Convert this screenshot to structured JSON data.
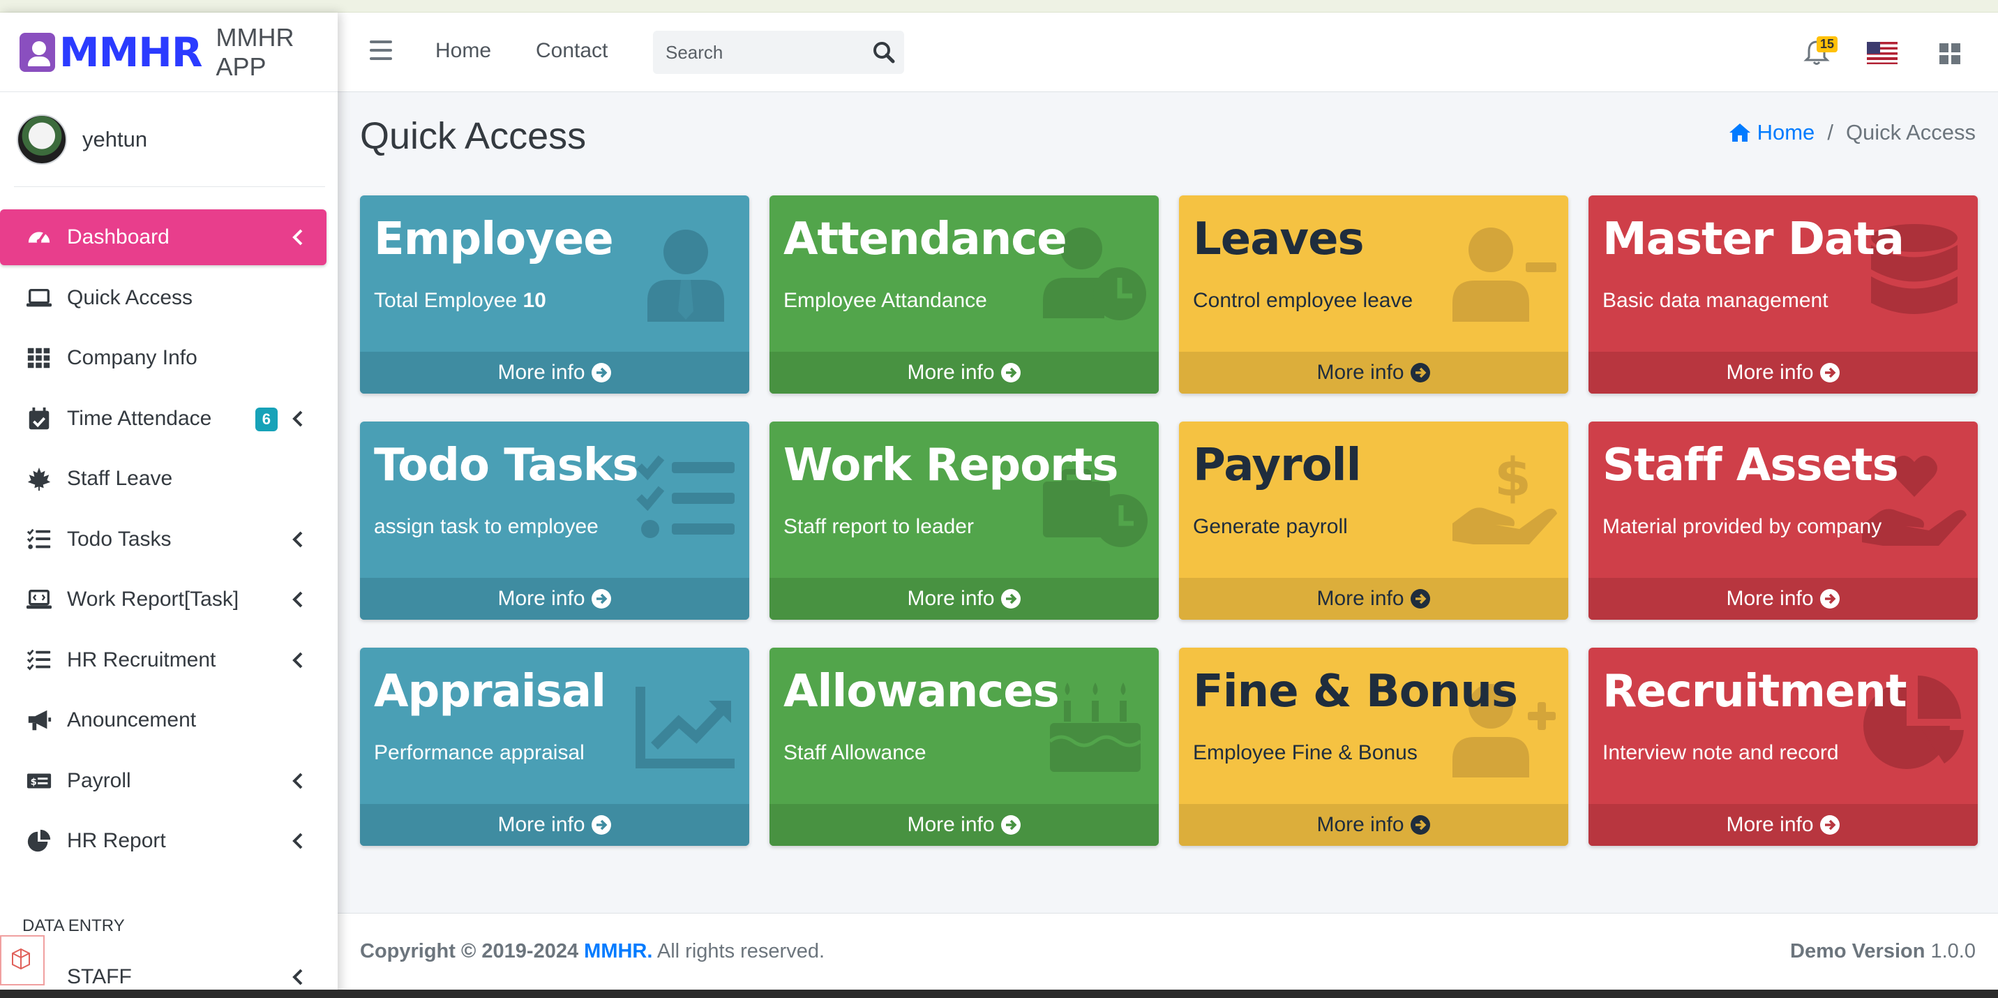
{
  "brand": {
    "logo_text": "MMHR",
    "app_name": "MMHR APP"
  },
  "user": {
    "name": "yehtun"
  },
  "sidebar": {
    "items": [
      {
        "label": "Dashboard",
        "icon": "tachometer-icon",
        "chevron": true
      },
      {
        "label": "Quick Access",
        "icon": "laptop-icon",
        "chevron": false
      },
      {
        "label": "Company Info",
        "icon": "grid-icon",
        "chevron": false
      },
      {
        "label": "Time Attendace",
        "icon": "calendar-check-icon",
        "chevron": true,
        "badge": "6"
      },
      {
        "label": "Staff Leave",
        "icon": "maple-leaf-icon",
        "chevron": false
      },
      {
        "label": "Todo Tasks",
        "icon": "tasks-icon",
        "chevron": true
      },
      {
        "label": "Work Report[Task]",
        "icon": "laptop-code-icon",
        "chevron": true
      },
      {
        "label": "HR Recruitment",
        "icon": "list-check-icon",
        "chevron": true
      },
      {
        "label": "Anouncement",
        "icon": "bullhorn-icon",
        "chevron": false
      },
      {
        "label": "Payroll",
        "icon": "money-check-icon",
        "chevron": true
      },
      {
        "label": "HR Report",
        "icon": "pie-chart-icon",
        "chevron": true
      }
    ],
    "section_header": "DATA ENTRY",
    "partial_item": "STAFF"
  },
  "header": {
    "links": [
      "Home",
      "Contact"
    ],
    "search_placeholder": "Search",
    "notification_count": "15"
  },
  "page": {
    "title": "Quick Access",
    "breadcrumb": {
      "home": "Home",
      "current": "Quick Access"
    }
  },
  "cards": [
    {
      "title": "Employee",
      "subtitle": "Total Employee ",
      "subtitle_bold": "10",
      "footer": "More info",
      "color": "info",
      "icon": "user-tie-icon"
    },
    {
      "title": "Attendance",
      "subtitle": "Employee Attandance",
      "subtitle_bold": "",
      "footer": "More info",
      "color": "success",
      "icon": "user-clock-icon"
    },
    {
      "title": "Leaves",
      "subtitle": "Control employee leave",
      "subtitle_bold": "",
      "footer": "More info",
      "color": "warning",
      "icon": "user-minus-icon"
    },
    {
      "title": "Master Data",
      "subtitle": "Basic data management",
      "subtitle_bold": "",
      "footer": "More info",
      "color": "danger",
      "icon": "database-icon"
    },
    {
      "title": "Todo Tasks",
      "subtitle": "assign task to employee",
      "subtitle_bold": "",
      "footer": "More info",
      "color": "info",
      "icon": "tasks-icon"
    },
    {
      "title": "Work Reports",
      "subtitle": "Staff report to leader",
      "subtitle_bold": "",
      "footer": "More info",
      "color": "success",
      "icon": "business-time-icon"
    },
    {
      "title": "Payroll",
      "subtitle": "Generate payroll",
      "subtitle_bold": "",
      "footer": "More info",
      "color": "warning",
      "icon": "hand-holding-usd-icon"
    },
    {
      "title": "Staff Assets",
      "subtitle": "Material provided by company",
      "subtitle_bold": "",
      "footer": "More info",
      "color": "danger",
      "icon": "hand-holding-heart-icon"
    },
    {
      "title": "Appraisal",
      "subtitle": "Performance appraisal",
      "subtitle_bold": "",
      "footer": "More info",
      "color": "info",
      "icon": "chart-line-icon"
    },
    {
      "title": "Allowances",
      "subtitle": "Staff Allowance",
      "subtitle_bold": "",
      "footer": "More info",
      "color": "success",
      "icon": "birthday-cake-icon"
    },
    {
      "title": "Fine & Bonus",
      "subtitle": "Employee Fine & Bonus",
      "subtitle_bold": "",
      "footer": "More info",
      "color": "warning",
      "icon": "user-plus-icon"
    },
    {
      "title": "Recruitment",
      "subtitle": "Interview note and record",
      "subtitle_bold": "",
      "footer": "More info",
      "color": "danger",
      "icon": "chart-pie-icon"
    }
  ],
  "footer": {
    "copyright_prefix": "Copyright © 2019-2024 ",
    "brand": "MMHR.",
    "suffix": " All rights reserved.",
    "version_label": "Demo Version",
    "version": " 1.0.0"
  },
  "colors": {
    "info": "#4a9fb5",
    "success": "#52a54b",
    "warning": "#f5c242",
    "danger": "#cf3f49",
    "active_nav": "#e83e8c",
    "link": "#007bff"
  }
}
